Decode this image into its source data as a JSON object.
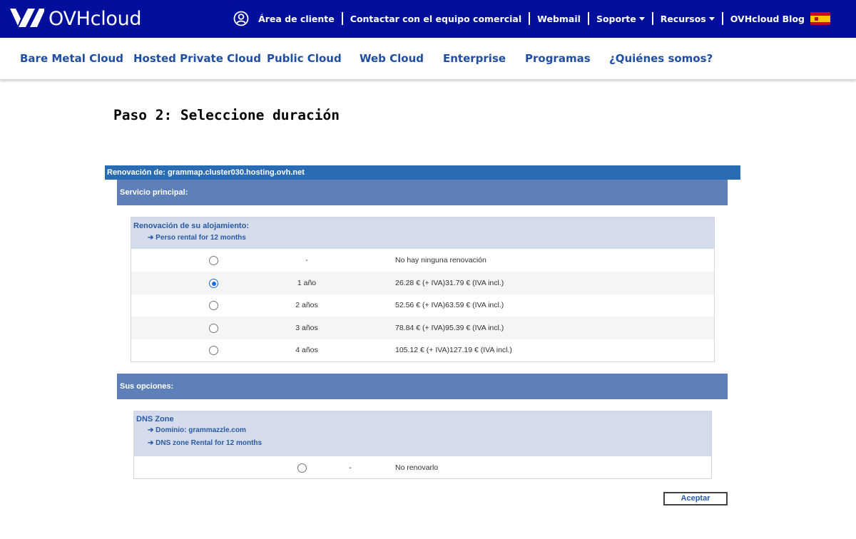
{
  "header": {
    "brand": "OVHcloud",
    "nav": [
      {
        "label": "Área de cliente"
      },
      {
        "label": "Contactar con el equipo comercial"
      },
      {
        "label": "Webmail"
      },
      {
        "label": "Soporte"
      },
      {
        "label": "Recursos"
      },
      {
        "label": "OVHcloud Blog"
      }
    ],
    "flag_icon": "spain-flag-icon"
  },
  "subnav": [
    {
      "label": "Bare Metal Cloud"
    },
    {
      "label": "Hosted Private Cloud"
    },
    {
      "label": "Public Cloud"
    },
    {
      "label": "Web Cloud"
    },
    {
      "label": "Enterprise"
    },
    {
      "label": "Programas"
    },
    {
      "label": "¿Quiénes somos?"
    }
  ],
  "page_title": "Paso 2: Seleccione duración",
  "renewal_bar": "Renovación de: grammap.cluster030.hosting.ovh.net",
  "main_service": {
    "heading": "Servicio principal:",
    "box_title": "Renovación de su alojamiento:",
    "box_sub": "➔ Perso rental for 12 months",
    "options": [
      {
        "duration": "-",
        "price": "No hay ninguna renovación",
        "selected": false
      },
      {
        "duration": "1 año",
        "price": "26.28 € (+ IVA)31.79 € (IVA incl.)",
        "selected": true
      },
      {
        "duration": "2 años",
        "price": "52.56 € (+ IVA)63.59 € (IVA incl.)",
        "selected": false
      },
      {
        "duration": "3 años",
        "price": "78.84 € (+ IVA)95.39 € (IVA incl.)",
        "selected": false
      },
      {
        "duration": "4 años",
        "price": "105.12 € (+ IVA)127.19 € (IVA incl.)",
        "selected": false
      }
    ]
  },
  "options_section": {
    "heading": "Sus opciones:",
    "box_title": "DNS Zone",
    "box_sub1": "➔ Dominio:  grammazzle.com",
    "box_sub2": "➔ DNS zone Rental for 12 months",
    "options": [
      {
        "duration": "-",
        "price": "No renovarlo",
        "selected": false
      }
    ]
  },
  "accept_label": "Aceptar",
  "colors": {
    "top_bar": "#000e9c",
    "link_blue": "#1f4ea3",
    "renewal_bar": "#2a6cb4",
    "section_bar": "#5e80b8",
    "box_head": "#d4dcec"
  }
}
